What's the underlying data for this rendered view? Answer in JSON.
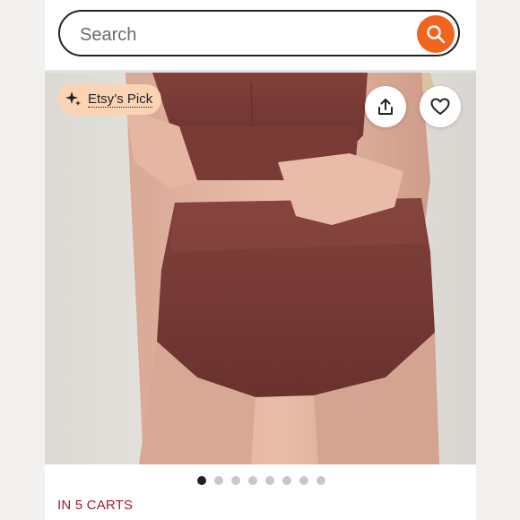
{
  "search": {
    "placeholder": "Search",
    "button_icon": "search-icon"
  },
  "badge": {
    "label": "Etsy’s Pick",
    "icon": "sparkle-icon"
  },
  "actions": {
    "share_icon": "share-icon",
    "favorite_icon": "heart-icon"
  },
  "carousel": {
    "total_images": 8,
    "active_index": 0
  },
  "status": {
    "carts_text": "IN 5 CARTS"
  },
  "colors": {
    "accent": "#f1641e",
    "badge_bg": "#fbd3b5",
    "carts_text": "#a61a2e",
    "fabric": "#7a3a36"
  }
}
